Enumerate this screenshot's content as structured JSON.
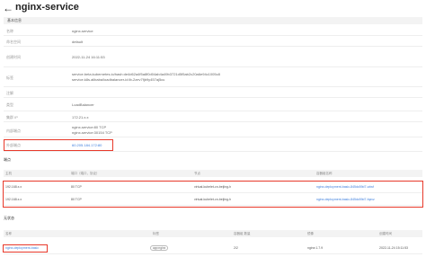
{
  "header": {
    "title": "nginx-service"
  },
  "basic": {
    "title": "基本信息",
    "fields": [
      {
        "key": "名称",
        "value": "nginx-service"
      },
      {
        "key": "命名空间",
        "value": "default"
      },
      {
        "key": "创建时间",
        "value": "2022-11-24 16:11:53"
      },
      {
        "key": "标签",
        "value": "service.beta.kubernetes.io/hash:de4d62a4f5a8f0d04ab4a49b3721d5f5ab2c20a6e94c1005c8",
        "value2": "service.k8s.alibaba/loadbalancer-id:lb-2zev7fjb9y457aj5cu"
      },
      {
        "key": "注解",
        "value": ""
      },
      {
        "key": "类型",
        "value": "LoadBalancer"
      },
      {
        "key": "集群 IP",
        "value": "172.21.x.x"
      },
      {
        "key": "内部端点",
        "value": "nginx-service:80 TCP",
        "value2": "nginx-service:30154 TCP"
      },
      {
        "key": "外部端点",
        "value": "60.205.184.172:80"
      }
    ]
  },
  "endpoints": {
    "title": "端点",
    "columns": [
      "主机",
      "端口（端口，协议）",
      "节点",
      "容器组名称"
    ],
    "rows": [
      {
        "host": "192.168.x.x",
        "port": "80 TCP",
        "node": "virtual-kubelet-cn-beijing-h",
        "pod": "nginx-deployment-basic-845dc59d7-vdwf"
      },
      {
        "host": "192.168.x.x",
        "port": "80 TCP",
        "node": "virtual-kubelet-cn-beijing-h",
        "pod": "nginx-deployment-basic-845dc59d7-fqxvz"
      }
    ]
  },
  "workloads": {
    "title": "无状态",
    "columns": [
      "名称",
      "标签",
      "容器组 数量",
      "镜像",
      "创建时间"
    ],
    "rows": [
      {
        "name": "nginx-deployment-basic",
        "label": "app:nginx",
        "count": "2/2",
        "image": "nginx:1.7.9",
        "created": "2022-11-24 15:11:53"
      }
    ]
  },
  "colors": {
    "highlight": "#e8392a",
    "link": "#3b7ddd"
  }
}
